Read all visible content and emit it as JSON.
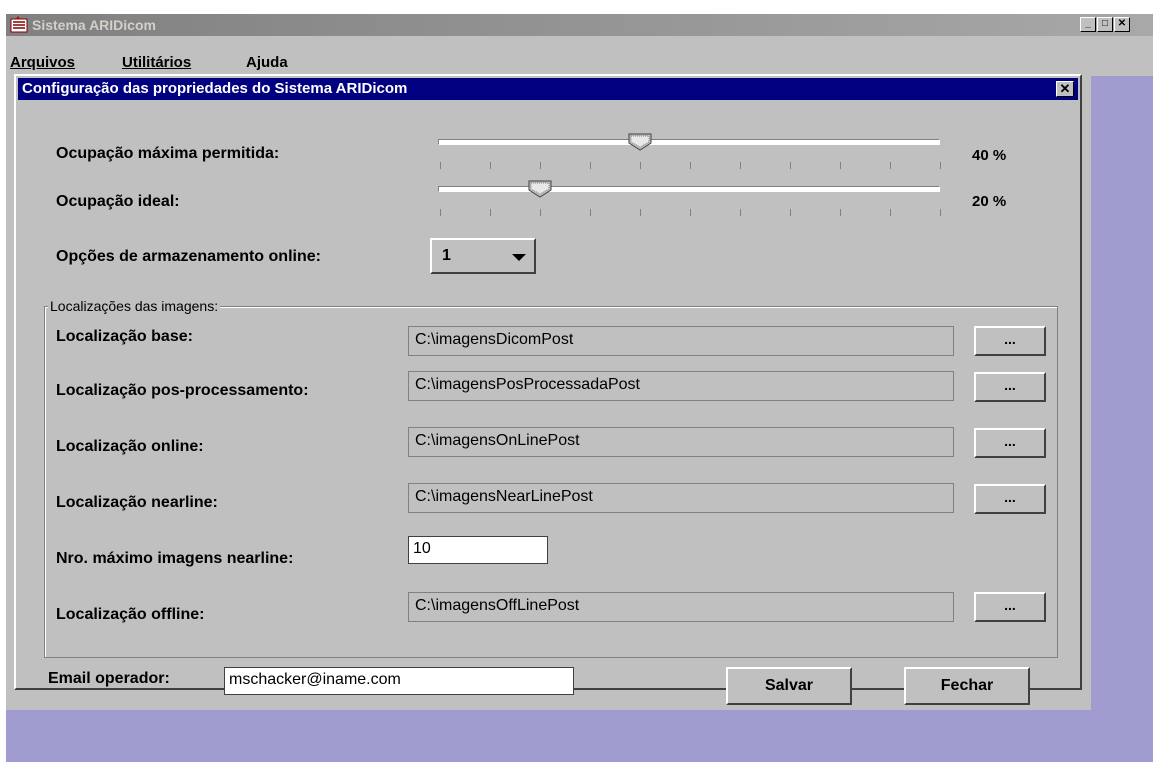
{
  "app": {
    "title": "Sistema ARIDicom"
  },
  "menu": {
    "items": [
      "Arquivos",
      "Utilitários",
      "Ajuda"
    ]
  },
  "dialog": {
    "title": "Configuração das propriedades do Sistema ARIDicom",
    "close": "✕",
    "ocupacao_max": {
      "label": "Ocupação máxima permitida:",
      "value_text": "40 %",
      "value": 40
    },
    "ocupacao_ideal": {
      "label": "Ocupação ideal:",
      "value_text": "20 %",
      "value": 20
    },
    "armazenamento": {
      "label": "Opções de armazenamento online:",
      "selected": "1"
    },
    "group_title": "Localizações das imagens:",
    "locations": [
      {
        "label": "Localização base:",
        "value": "C:\\imagensDicomPost",
        "button": "..."
      },
      {
        "label": "Localização pos-processamento:",
        "value": "C:\\imagensPosProcessadaPost",
        "button": "..."
      },
      {
        "label": "Localização online:",
        "value": "C:\\imagensOnLinePost",
        "button": "..."
      },
      {
        "label": "Localização nearline:",
        "value": "C:\\imagensNearLinePost",
        "button": "..."
      }
    ],
    "max_nearline": {
      "label": "Nro. máximo imagens nearline:",
      "value": "10"
    },
    "offline": {
      "label": "Localização offline:",
      "value": "C:\\imagensOffLinePost",
      "button": "..."
    },
    "email": {
      "label": "Email operador:",
      "value": "mschacker@iname.com"
    },
    "save_label": "Salvar",
    "close_label": "Fechar"
  }
}
